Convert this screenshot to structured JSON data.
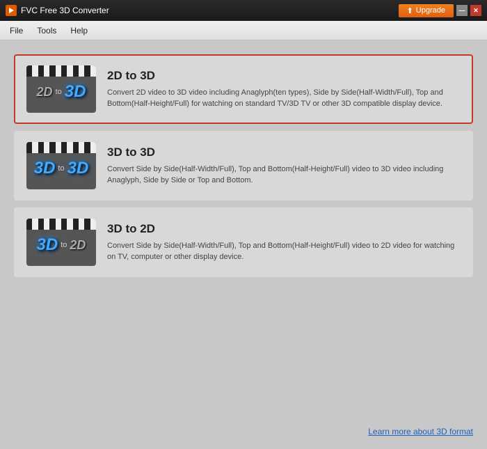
{
  "titlebar": {
    "app_title": "FVC Free 3D Converter",
    "upgrade_label": "Upgrade"
  },
  "menubar": {
    "items": [
      {
        "label": "File"
      },
      {
        "label": "Tools"
      },
      {
        "label": "Help"
      }
    ]
  },
  "options": [
    {
      "id": "2d-to-3d",
      "title": "2D to 3D",
      "description": "Convert 2D video to 3D video including Anaglyph(ten types), Side by Side(Half-Width/Full), Top and Bottom(Half-Height/Full) for watching on standard TV/3D TV or other 3D compatible display device.",
      "from": "2D",
      "to": "3D",
      "selected": true
    },
    {
      "id": "3d-to-3d",
      "title": "3D to 3D",
      "description": "Convert Side by Side(Half-Width/Full), Top and Bottom(Half-Height/Full) video to 3D video including Anaglyph, Side by Side or Top and Bottom.",
      "from": "3D",
      "to": "3D",
      "selected": false
    },
    {
      "id": "3d-to-2d",
      "title": "3D to 2D",
      "description": "Convert Side by Side(Half-Width/Full), Top and Bottom(Half-Height/Full) video to 2D video for watching on TV, computer or other display device.",
      "from": "3D",
      "to": "2D",
      "selected": false
    }
  ],
  "bottom": {
    "learn_more_label": "Learn more about 3D format"
  },
  "winButtons": {
    "minimize": "—",
    "close": "✕"
  }
}
